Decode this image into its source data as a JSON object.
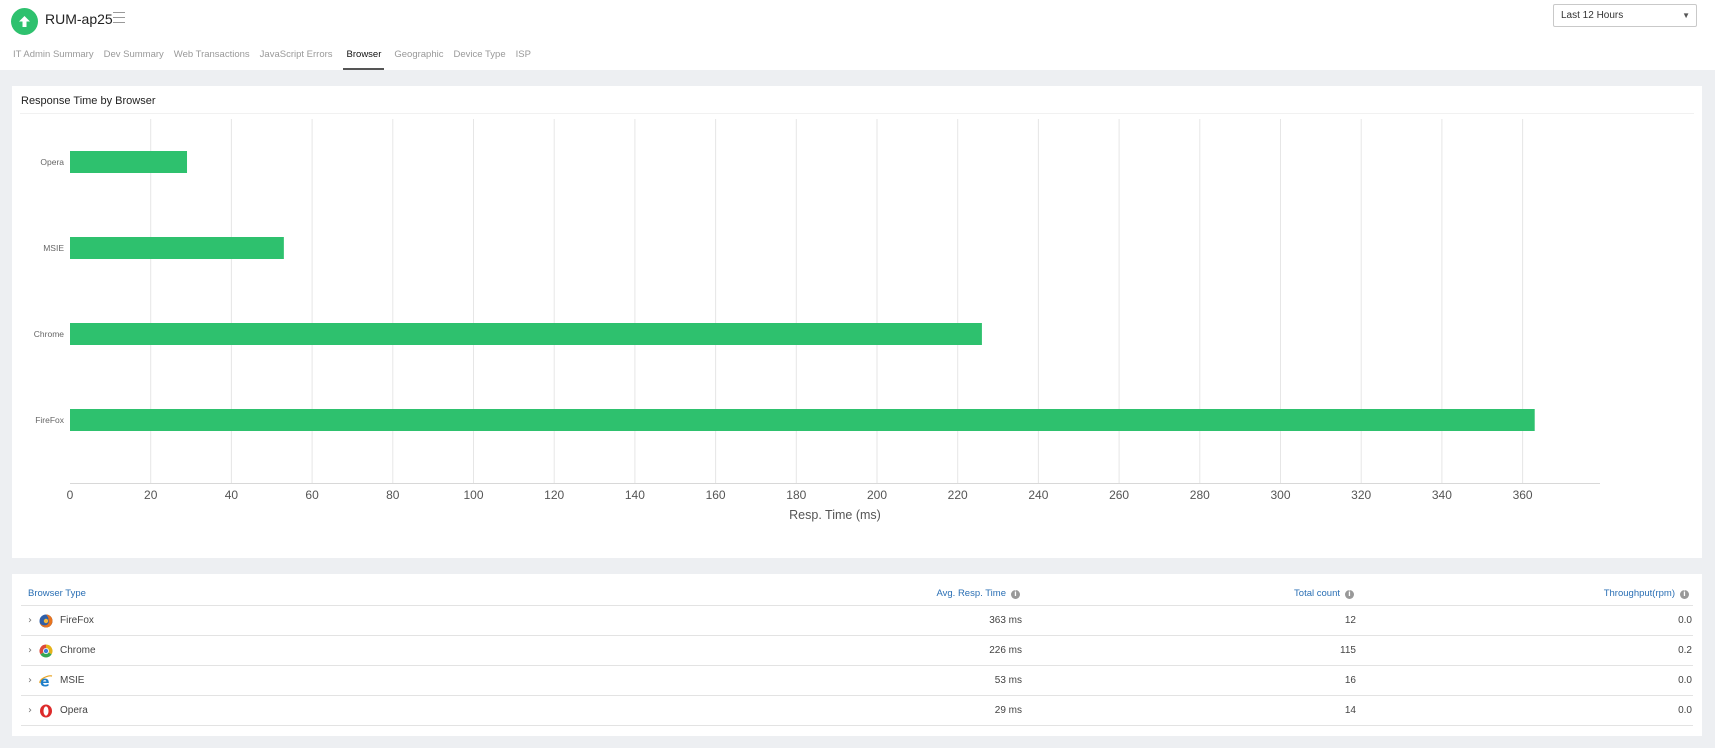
{
  "header": {
    "monitor_name": "RUM-ap25",
    "time_range": "Last 12 Hours",
    "status_color": "#2ec16e"
  },
  "tabs": [
    {
      "label": "IT Admin Summary",
      "active": false
    },
    {
      "label": "Dev Summary",
      "active": false
    },
    {
      "label": "Web Transactions",
      "active": false
    },
    {
      "label": "JavaScript Errors",
      "active": false
    },
    {
      "label": "Browser",
      "active": true
    },
    {
      "label": "Geographic",
      "active": false
    },
    {
      "label": "Device Type",
      "active": false
    },
    {
      "label": "ISP",
      "active": false
    }
  ],
  "chart_panel": {
    "title": "Response Time by Browser"
  },
  "chart_data": {
    "type": "bar",
    "orientation": "horizontal",
    "categories": [
      "Opera",
      "MSIE",
      "Chrome",
      "FireFox"
    ],
    "values": [
      29,
      53,
      226,
      363
    ],
    "xlabel": "Resp. Time (ms)",
    "ylabel": "",
    "xlim": [
      0,
      380
    ],
    "xticks": [
      0,
      20,
      40,
      60,
      80,
      100,
      120,
      140,
      160,
      180,
      200,
      220,
      240,
      260,
      280,
      300,
      320,
      340,
      360
    ],
    "bar_color": "#2ec16e",
    "grid": true
  },
  "table": {
    "headers": {
      "browser": "Browser Type",
      "avg_resp": "Avg. Resp. Time",
      "count": "Total count",
      "throughput": "Throughput(rpm)"
    },
    "rows": [
      {
        "browser": "FireFox",
        "icon": "firefox-icon",
        "avg_resp": "363 ms",
        "count": "12",
        "throughput": "0.0"
      },
      {
        "browser": "Chrome",
        "icon": "chrome-icon",
        "avg_resp": "226 ms",
        "count": "115",
        "throughput": "0.2"
      },
      {
        "browser": "MSIE",
        "icon": "ie-icon",
        "avg_resp": "53 ms",
        "count": "16",
        "throughput": "0.0"
      },
      {
        "browser": "Opera",
        "icon": "opera-icon",
        "avg_resp": "29 ms",
        "count": "14",
        "throughput": "0.0"
      }
    ]
  },
  "colors": {
    "accent_green": "#2ec16e",
    "link_blue": "#2a6fb4",
    "page_bg": "#edeff2"
  }
}
